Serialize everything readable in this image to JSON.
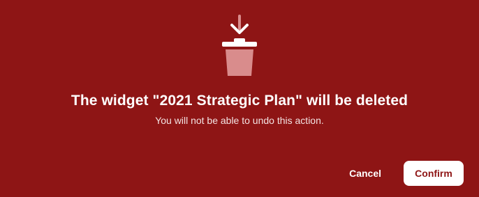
{
  "dialog": {
    "title": "The widget \"2021 Strategic Plan\" will be deleted",
    "subtitle": "You will not be able to undo this action.",
    "icon": "trash-delete-icon",
    "background_color": "#8E1515"
  },
  "actions": {
    "cancel_label": "Cancel",
    "confirm_label": "Confirm"
  }
}
